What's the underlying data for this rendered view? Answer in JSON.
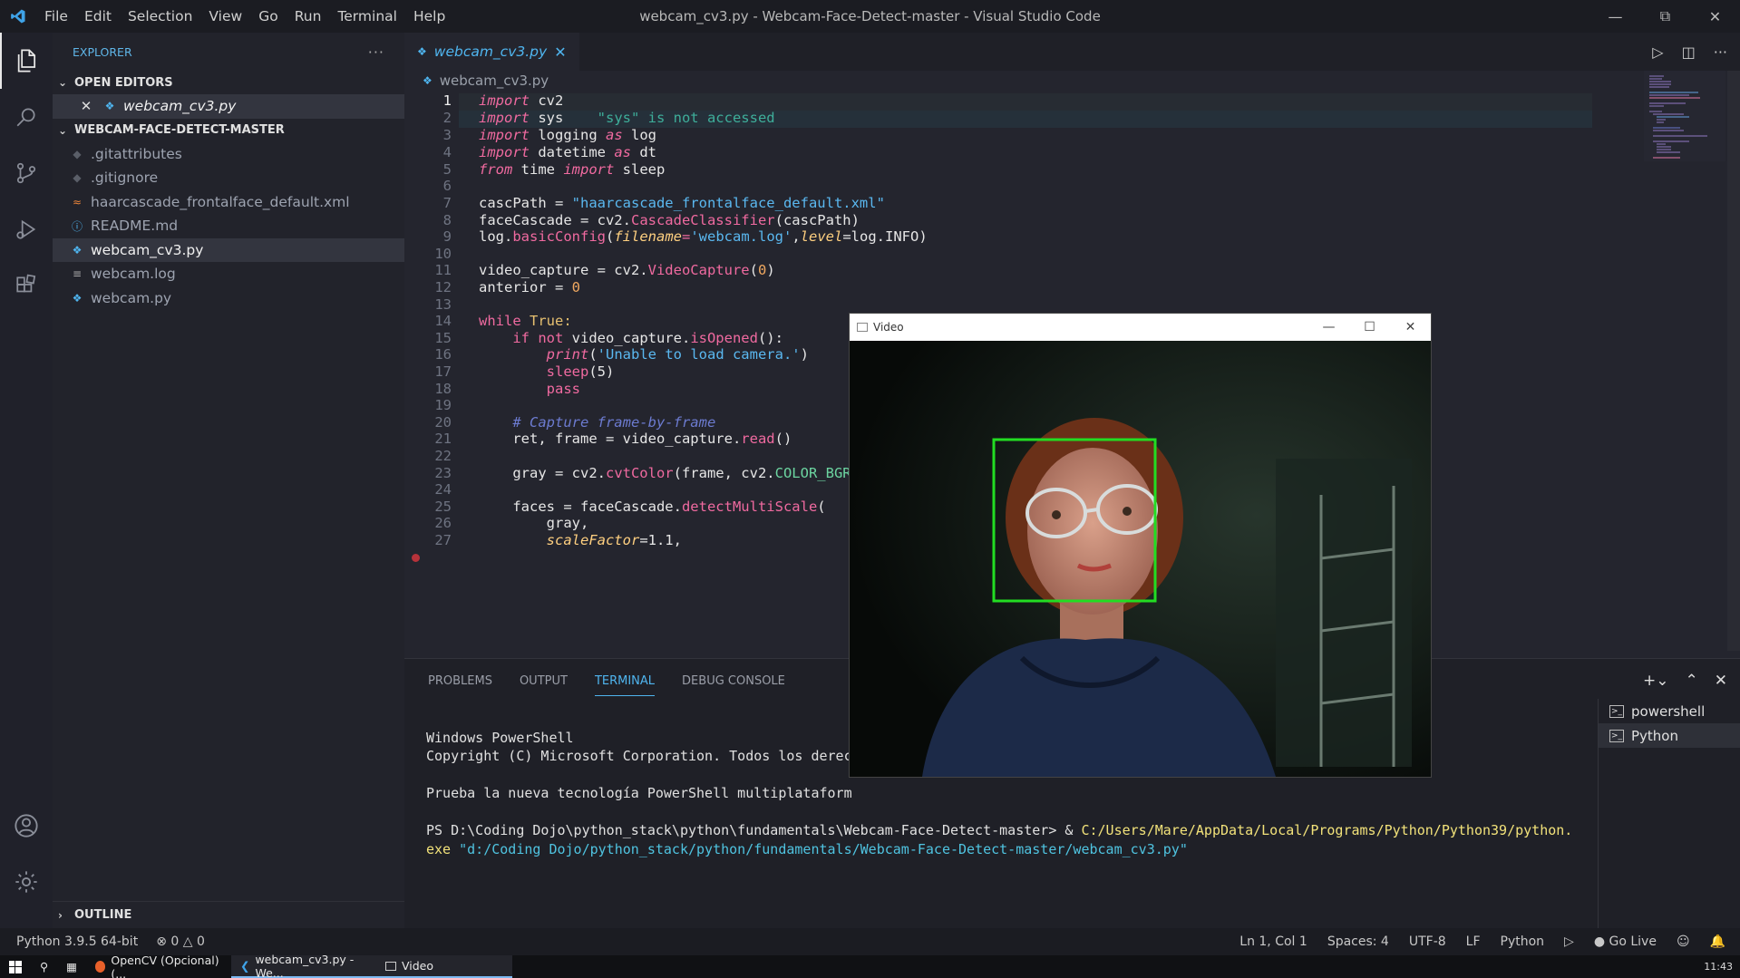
{
  "titlebar": {
    "menu": [
      "File",
      "Edit",
      "Selection",
      "View",
      "Go",
      "Run",
      "Terminal",
      "Help"
    ],
    "title": "webcam_cv3.py - Webcam-Face-Detect-master - Visual Studio Code"
  },
  "sidebar": {
    "header": "EXPLORER",
    "open_editors_label": "OPEN EDITORS",
    "open_editor_file": "webcam_cv3.py",
    "folder_label": "WEBCAM-FACE-DETECT-MASTER",
    "files": [
      {
        "name": ".gitattributes",
        "icon": "git-icon"
      },
      {
        "name": ".gitignore",
        "icon": "git-icon"
      },
      {
        "name": "haarcascade_frontalface_default.xml",
        "icon": "rss-icon"
      },
      {
        "name": "README.md",
        "icon": "info-icon"
      },
      {
        "name": "webcam_cv3.py",
        "icon": "python-icon"
      },
      {
        "name": "webcam.log",
        "icon": "lines-icon"
      },
      {
        "name": "webcam.py",
        "icon": "python-icon"
      }
    ],
    "outline_label": "OUTLINE"
  },
  "editor": {
    "tab_label": "webcam_cv3.py",
    "breadcrumb": "webcam_cv3.py",
    "line_numbers": [
      "1",
      "2",
      "3",
      "4",
      "5",
      "6",
      "7",
      "8",
      "9",
      "10",
      "11",
      "12",
      "13",
      "14",
      "15",
      "16",
      "17",
      "18",
      "19",
      "20",
      "21",
      "22",
      "23",
      "24",
      "25",
      "26",
      "27"
    ],
    "code": {
      "l1_a": "import",
      "l1_b": " cv2",
      "l2_a": "import",
      "l2_b": " sys",
      "l2_hint": "    \"sys\" is not accessed",
      "l3_a": "import",
      "l3_b": " logging ",
      "l3_c": "as",
      "l3_d": " log",
      "l4_a": "import",
      "l4_b": " datetime ",
      "l4_c": "as",
      "l4_d": " dt",
      "l5_a": "from",
      "l5_b": " time ",
      "l5_c": "import",
      "l5_d": " sleep",
      "l7_a": "cascPath = ",
      "l7_b": "\"haarcascade_frontalface_default.xml\"",
      "l8_a": "faceCascade = cv2.",
      "l8_b": "CascadeClassifier",
      "l8_c": "(cascPath)",
      "l9_a": "log.",
      "l9_b": "basicConfig",
      "l9_c": "(",
      "l9_d": "filename",
      "l9_e": "=",
      "l9_f": "'webcam.log'",
      "l9_g": ",",
      "l9_h": "level",
      "l9_i": "=log.INFO)",
      "l11_a": "video_capture = cv2.",
      "l11_b": "VideoCapture",
      "l11_c": "(",
      "l11_d": "0",
      "l11_e": ")",
      "l12_a": "anterior = ",
      "l12_b": "0",
      "l14_a": "while",
      "l14_b": " True:",
      "l15_a": "    ",
      "l15_b": "if not",
      "l15_c": " video_capture.",
      "l15_d": "isOpened",
      "l15_e": "():",
      "l16_a": "        ",
      "l16_b": "print",
      "l16_c": "(",
      "l16_d": "'Unable to load camera.'",
      "l16_e": ")",
      "l17_a": "        ",
      "l17_b": "sleep",
      "l17_c": "(5)",
      "l18_a": "        ",
      "l18_b": "pass",
      "l20": "    # Capture frame-by-frame",
      "l21_a": "    ret, frame = video_capture.",
      "l21_b": "read",
      "l21_c": "()",
      "l23_a": "    gray = cv2.",
      "l23_b": "cvtColor",
      "l23_c": "(frame, cv2.",
      "l23_d": "COLOR_BGR",
      "l25_a": "    faces = faceCascade.",
      "l25_b": "detectMultiScale",
      "l25_c": "(",
      "l26": "        gray,",
      "l27_a": "        ",
      "l27_b": "scaleFactor",
      "l27_c": "=1.1,"
    }
  },
  "panel": {
    "tabs": [
      "PROBLEMS",
      "OUTPUT",
      "TERMINAL",
      "DEBUG CONSOLE"
    ],
    "terminal_lines": {
      "t1": "Windows PowerShell",
      "t2": "Copyright (C) Microsoft Corporation. Todos los derec",
      "t3": "Prueba la nueva tecnología PowerShell multiplataform",
      "t4_a": "PS D:\\Coding Dojo\\python_stack\\python\\fundamentals\\Webcam-Face-Detect-master> & ",
      "t4_b": "C:/Users/Mare/AppData/Local/Programs/Python/Python39/python.",
      "t5_a": "exe ",
      "t5_b": "\"d:/Coding Dojo/python_stack/python/fundamentals/Webcam-Face-Detect-master/webcam_cv3.py\""
    },
    "terminals": [
      "powershell",
      "Python"
    ]
  },
  "video_window": {
    "title": "Video"
  },
  "statusbar": {
    "python": "Python 3.9.5 64-bit",
    "errors": "0",
    "warnings": "0",
    "position": "Ln 1, Col 1",
    "spaces": "Spaces: 4",
    "encoding": "UTF-8",
    "eol": "LF",
    "language": "Python",
    "golive": "Go Live"
  },
  "taskbar": {
    "items": [
      "OpenCV (Opcional) (...",
      "webcam_cv3.py - We...",
      "Video"
    ],
    "clock": "11:43"
  },
  "colors": {
    "accent": "#4fb5ef",
    "keyword": "#f06aa0",
    "string": "#5ab8f0",
    "face_box": "#22dd22"
  }
}
